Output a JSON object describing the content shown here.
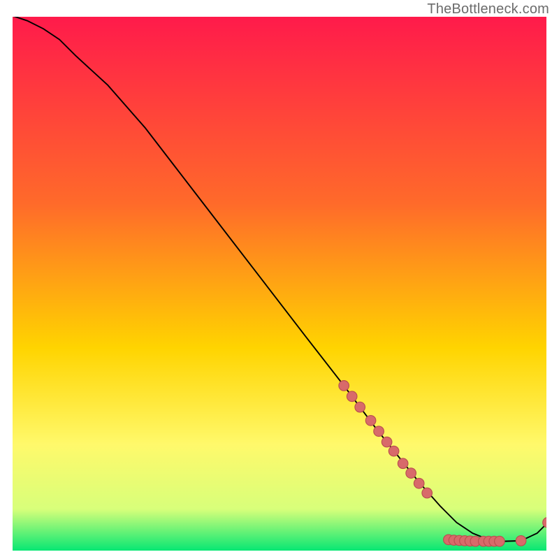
{
  "watermark": "TheBottleneck.com",
  "colors": {
    "gradient_top": "#ff1a4b",
    "gradient_mid1": "#ff6a2a",
    "gradient_mid2": "#ffd400",
    "gradient_low1": "#fff96b",
    "gradient_low2": "#d8ff7a",
    "gradient_bottom": "#00e673",
    "curve": "#000000",
    "marker_fill": "#d86a6a",
    "marker_stroke": "#b94f4f"
  },
  "chart_data": {
    "type": "line",
    "title": "",
    "xlabel": "",
    "ylabel": "",
    "xlim": [
      0,
      100
    ],
    "ylim": [
      0,
      100
    ],
    "series": [
      {
        "name": "curve",
        "x": [
          0,
          3,
          6,
          9,
          12,
          18,
          25,
          35,
          45,
          55,
          62,
          68,
          72,
          76,
          80,
          83,
          86,
          89,
          92,
          95,
          98,
          100
        ],
        "y": [
          100,
          99,
          97.5,
          95.5,
          92.5,
          87,
          79,
          66,
          53,
          40,
          31,
          23,
          18,
          13,
          8.5,
          5.5,
          3.5,
          2.3,
          2.0,
          2.1,
          3.5,
          5.5
        ]
      }
    ],
    "markers": [
      {
        "x": 62,
        "y": 31
      },
      {
        "x": 63.5,
        "y": 29
      },
      {
        "x": 65,
        "y": 27
      },
      {
        "x": 67,
        "y": 24.5
      },
      {
        "x": 68.5,
        "y": 22.5
      },
      {
        "x": 70,
        "y": 20.5
      },
      {
        "x": 71.3,
        "y": 18.8
      },
      {
        "x": 73,
        "y": 16.5
      },
      {
        "x": 74.5,
        "y": 14.7
      },
      {
        "x": 76,
        "y": 12.8
      },
      {
        "x": 77.5,
        "y": 11
      },
      {
        "x": 81.5,
        "y": 2.3
      },
      {
        "x": 82.5,
        "y": 2.2
      },
      {
        "x": 83.5,
        "y": 2.15
      },
      {
        "x": 84.5,
        "y": 2.1
      },
      {
        "x": 85.5,
        "y": 2.05
      },
      {
        "x": 86.5,
        "y": 2.0
      },
      {
        "x": 88,
        "y": 2.0
      },
      {
        "x": 89,
        "y": 2.0
      },
      {
        "x": 90,
        "y": 2.0
      },
      {
        "x": 91,
        "y": 2.0
      },
      {
        "x": 95,
        "y": 2.1
      },
      {
        "x": 100,
        "y": 5.5
      }
    ]
  }
}
